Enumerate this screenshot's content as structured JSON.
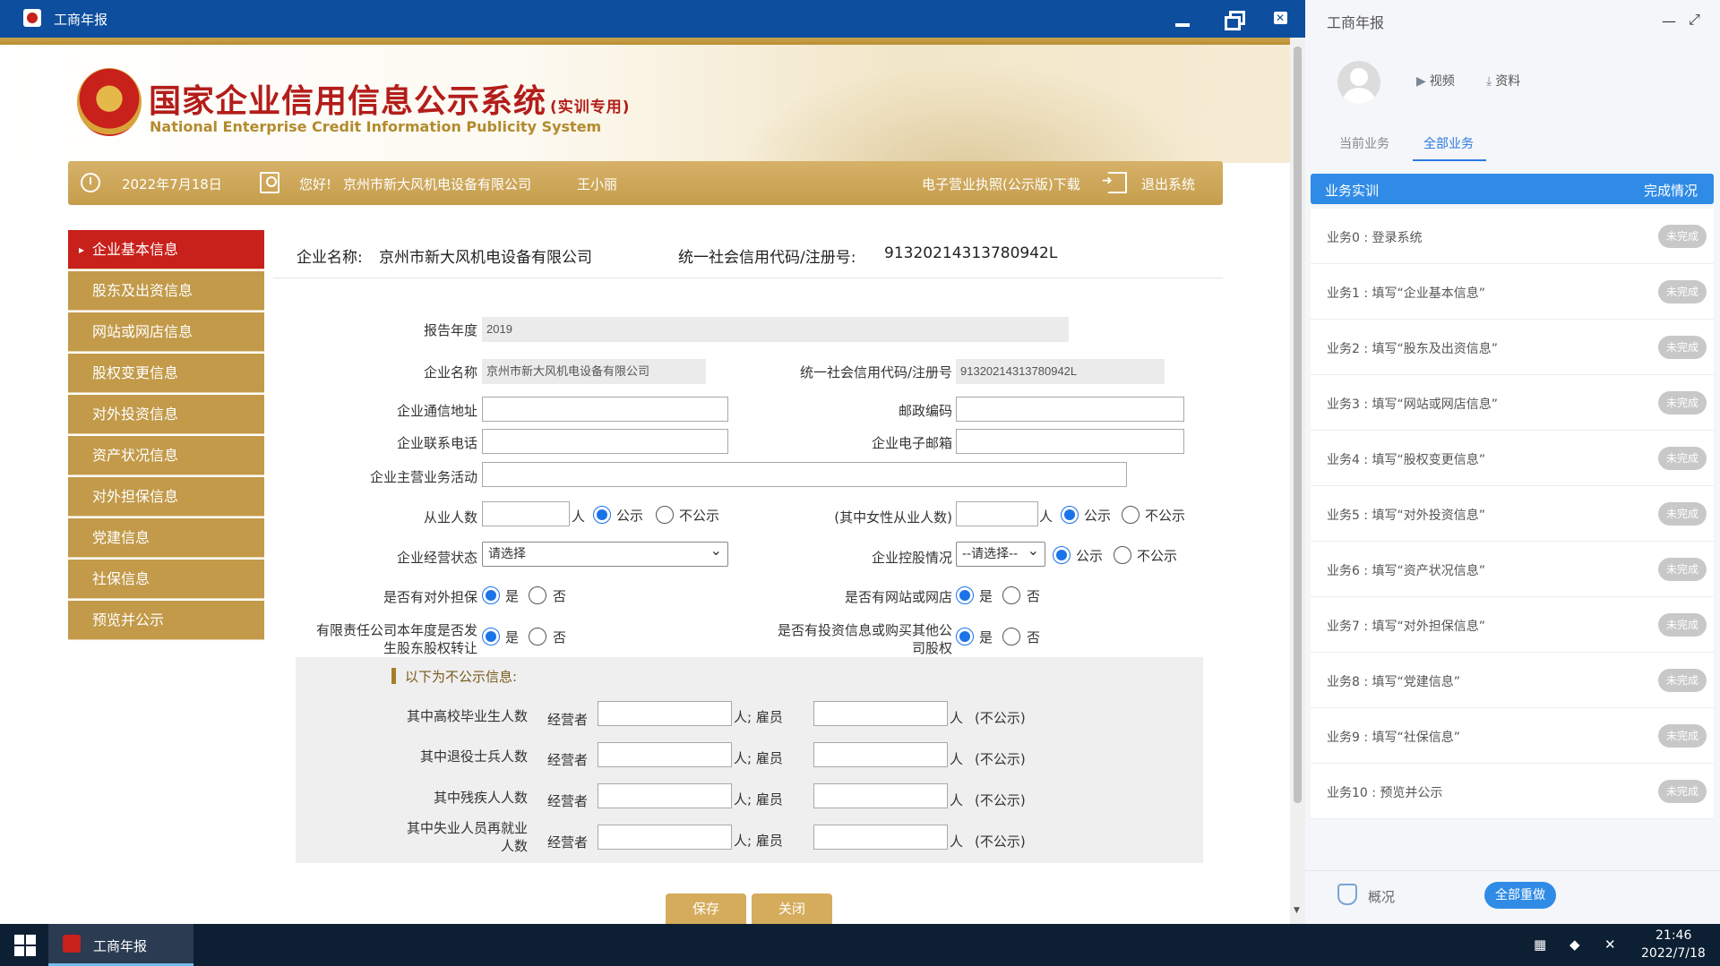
{
  "window": {
    "title": "工商年报",
    "minimize": "—",
    "restore": "❐",
    "close": "✕"
  },
  "header": {
    "title": "国家企业信用信息公示系统",
    "title_tag": "(实训专用)",
    "subtitle": "National Enterprise Credit Information Publicity System"
  },
  "info_bar": {
    "date": "2022年7月18日",
    "greeting": "您好!",
    "company": "京州市新大风机电设备有限公司",
    "user": "王小丽",
    "license_download": "电子营业执照(公示版)下载",
    "logout": "退出系统"
  },
  "side_menu": {
    "items": [
      {
        "label": "企业基本信息",
        "active": true
      },
      {
        "label": "股东及出资信息"
      },
      {
        "label": "网站或网店信息"
      },
      {
        "label": "股权变更信息"
      },
      {
        "label": "对外投资信息"
      },
      {
        "label": "资产状况信息"
      },
      {
        "label": "对外担保信息"
      },
      {
        "label": "党建信息"
      },
      {
        "label": "社保信息"
      },
      {
        "label": "预览并公示"
      }
    ]
  },
  "company_head": {
    "name_label": "企业名称:",
    "name": "京州市新大风机电设备有限公司",
    "code_label": "统一社会信用代码/注册号:",
    "code": "91320214313780942L"
  },
  "form": {
    "report_year_label": "报告年度",
    "report_year": "2019",
    "company_name_label": "企业名称",
    "company_name": "京州市新大风机电设备有限公司",
    "credit_code_label": "统一社会信用代码/注册号",
    "credit_code": "91320214313780942L",
    "address_label": "企业通信地址",
    "address": "",
    "postcode_label": "邮政编码",
    "postcode": "",
    "phone_label": "企业联系电话",
    "phone": "",
    "email_label": "企业电子邮箱",
    "email": "",
    "business_label": "企业主营业务活动",
    "business": "",
    "employees_label": "从业人数",
    "employees": "",
    "person_unit": "人",
    "public": "公示",
    "not_public": "不公示",
    "female_label": "(其中女性从业人数)",
    "female": "",
    "status_label": "企业经营状态",
    "status_value": "请选择",
    "holding_label": "企业控股情况",
    "holding_value": "--请选择--",
    "guarantee_label": "是否有对外担保",
    "yes": "是",
    "no": "否",
    "website_label": "是否有网站或网店",
    "equity_transfer_label_1": "有限责任公司本年度是否发",
    "equity_transfer_label_2": "生股东股权转让",
    "investment_label_1": "是否有投资信息或购买其他公",
    "investment_label_2": "司股权"
  },
  "private_section": {
    "heading": "以下为不公示信息:",
    "operator": "经营者",
    "employee_sep": "人; 雇员",
    "person_unit": "人",
    "not_public_note": "(不公示)",
    "rows": [
      {
        "label": "其中高校毕业生人数"
      },
      {
        "label": "其中退役士兵人数"
      },
      {
        "label": "其中残疾人人数"
      },
      {
        "label_1": "其中失业人员再就业",
        "label_2": "人数"
      }
    ]
  },
  "buttons": {
    "save": "保存",
    "close": "关闭"
  },
  "task_panel": {
    "title": "工商年报",
    "min": "—",
    "max": "⤢",
    "video": "视频",
    "material": "资料",
    "tab_current": "当前业务",
    "tab_all": "全部业务",
    "head_left": "业务实训",
    "head_right": "完成情况",
    "tasks": [
      {
        "name": "业务0 : 登录系统",
        "status": "未完成"
      },
      {
        "name": "业务1 : 填写“企业基本信息”",
        "status": "未完成"
      },
      {
        "name": "业务2 : 填写“股东及出资信息”",
        "status": "未完成"
      },
      {
        "name": "业务3 : 填写“网站或网店信息”",
        "status": "未完成"
      },
      {
        "name": "业务4 : 填写“股权变更信息”",
        "status": "未完成"
      },
      {
        "name": "业务5 : 填写“对外投资信息”",
        "status": "未完成"
      },
      {
        "name": "业务6 : 填写“资产状况信息”",
        "status": "未完成"
      },
      {
        "name": "业务7 : 填写“对外担保信息”",
        "status": "未完成"
      },
      {
        "name": "业务8 : 填写“党建信息”",
        "status": "未完成"
      },
      {
        "name": "业务9 : 填写“社保信息”",
        "status": "未完成"
      },
      {
        "name": "业务10 : 预览并公示",
        "status": "未完成"
      }
    ],
    "overview": "概况",
    "redo_all": "全部重做"
  },
  "taskbar": {
    "app_label": "工商年报",
    "time": "21:46",
    "date": "2022/7/18"
  },
  "colors": {
    "titlebar": "#0d4e9e",
    "gold": "#c29a49",
    "menu_active": "#c8201b",
    "accent_blue": "#2f8be6"
  }
}
